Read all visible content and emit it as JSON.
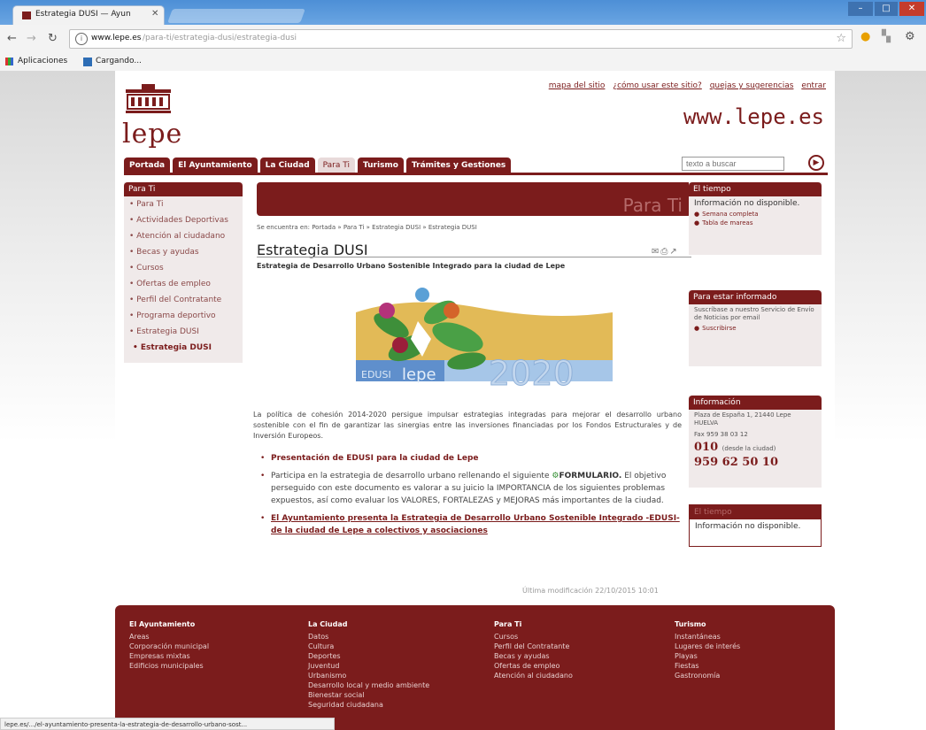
{
  "browser": {
    "tab_title": "Estrategia DUSI — Ayun",
    "tab_close": "✕",
    "url_host": "www.lepe.es",
    "url_path": "/para-ti/estrategia-dusi/estrategia-dusi",
    "bookmarks": [
      "Aplicaciones",
      "Cargando..."
    ],
    "status_url": "lepe.es/.../el-ayuntamiento-presenta-la-estrategia-de-desarrollo-urbano-sost..."
  },
  "header": {
    "logo_text": "lepe",
    "top_links": [
      "mapa del sitio",
      "¿cómo usar este sitio?",
      "quejas y sugerencias",
      "entrar"
    ],
    "site_url": "www.lepe.es"
  },
  "menu": {
    "items": [
      "Portada",
      "El Ayuntamiento",
      "La Ciudad",
      "Para Ti",
      "Turismo",
      "Trámites y Gestiones"
    ],
    "search_placeholder": "texto a buscar"
  },
  "left_nav": {
    "title": "Para Ti",
    "items": [
      "Para Ti",
      "Actividades Deportivas",
      "Atención al ciudadano",
      "Becas y ayudas",
      "Cursos",
      "Ofertas de empleo",
      "Perfil del Contratante",
      "Programa deportivo",
      "Estrategia DUSI"
    ],
    "subitem": "Estrategia DUSI"
  },
  "main": {
    "banner_text": "Para Ti",
    "breadcrumb": "Se encuentra en: Portada » Para Ti » Estrategia DUSI » Estrategia DUSI",
    "title": "Estrategia DUSI",
    "subtitle": "Estrategia de Desarrollo Urbano Sostenible Integrado para la ciudad de Lepe",
    "logo_label_1": "EDUSI",
    "logo_label_2": "lepe",
    "logo_label_3": "2020",
    "intro": "La política de cohesión 2014-2020 persigue impulsar estrategias integradas para mejorar el desarrollo urbano sostenible con el fin de garantizar las sinergias entre las inversiones financiadas por los Fondos Estructurales y de Inversión Europeos.",
    "bullet1": "Presentación de EDUSI para la ciudad de Lepe",
    "bullet2_a": "Participa en la estrategia de desarrollo urbano rellenando el siguiente",
    "bullet2_form": "FORMULARIO.",
    "bullet2_b": "El objetivo perseguido con este documento es valorar a su juicio la IMPORTANCIA de los siguientes problemas expuestos, así como evaluar los VALORES, FORTALEZAS y MEJORAS más importantes de la ciudad.",
    "bullet3": "El Ayuntamiento presenta la Estrategia de Desarrollo Urbano Sostenible Integrado -EDUSI- de la ciudad de Lepe a colectivos y asociaciones",
    "last_modified": "Última modificación 22/10/2015 10:01"
  },
  "right": {
    "weather_title": "El tiempo",
    "weather_text": "Información no disponible.",
    "weather_links": [
      "Semana completa",
      "Tabla de mareas"
    ],
    "informed_title": "Para estar informado",
    "informed_text": "Suscríbase a nuestro Servicio de Envío de Noticias por email",
    "informed_link": "Suscribirse",
    "info_title": "Información",
    "info_address": "Plaza de España 1, 21440 Lepe HUELVA",
    "info_fax": "Fax 959 38 03 12",
    "info_phone1": "010",
    "info_phone1_note": "(desde la ciudad)",
    "info_phone2": "959 62 50 10",
    "sms_title": "El tiempo",
    "sms_text": "Información no disponible."
  },
  "footer": {
    "columns": [
      {
        "title": "El Ayuntamiento",
        "items": [
          "Areas",
          "Corporación municipal",
          "Empresas mixtas",
          "Edificios municipales"
        ]
      },
      {
        "title": "La Ciudad",
        "items": [
          "Datos",
          "Cultura",
          "Deportes",
          "Juventud",
          "Urbanismo",
          "Desarrollo local y medio ambiente",
          "Bienestar social",
          "Seguridad ciudadana"
        ]
      },
      {
        "title": "Para Ti",
        "items": [
          "Cursos",
          "Perfil del Contratante",
          "Becas y ayudas",
          "Ofertas de empleo",
          "Atención al ciudadano"
        ]
      },
      {
        "title": "Turismo",
        "items": [
          "Instantáneas",
          "Lugares de interés",
          "Playas",
          "Fiestas",
          "Gastronomía"
        ]
      }
    ]
  },
  "colors": {
    "brand": "#7b1c1c",
    "panel": "#f0eaea"
  },
  "icons": [
    "back-icon",
    "forward-icon",
    "reload-icon",
    "info-icon",
    "star-icon",
    "search-icon",
    "email-icon",
    "print-icon",
    "share-icon"
  ]
}
